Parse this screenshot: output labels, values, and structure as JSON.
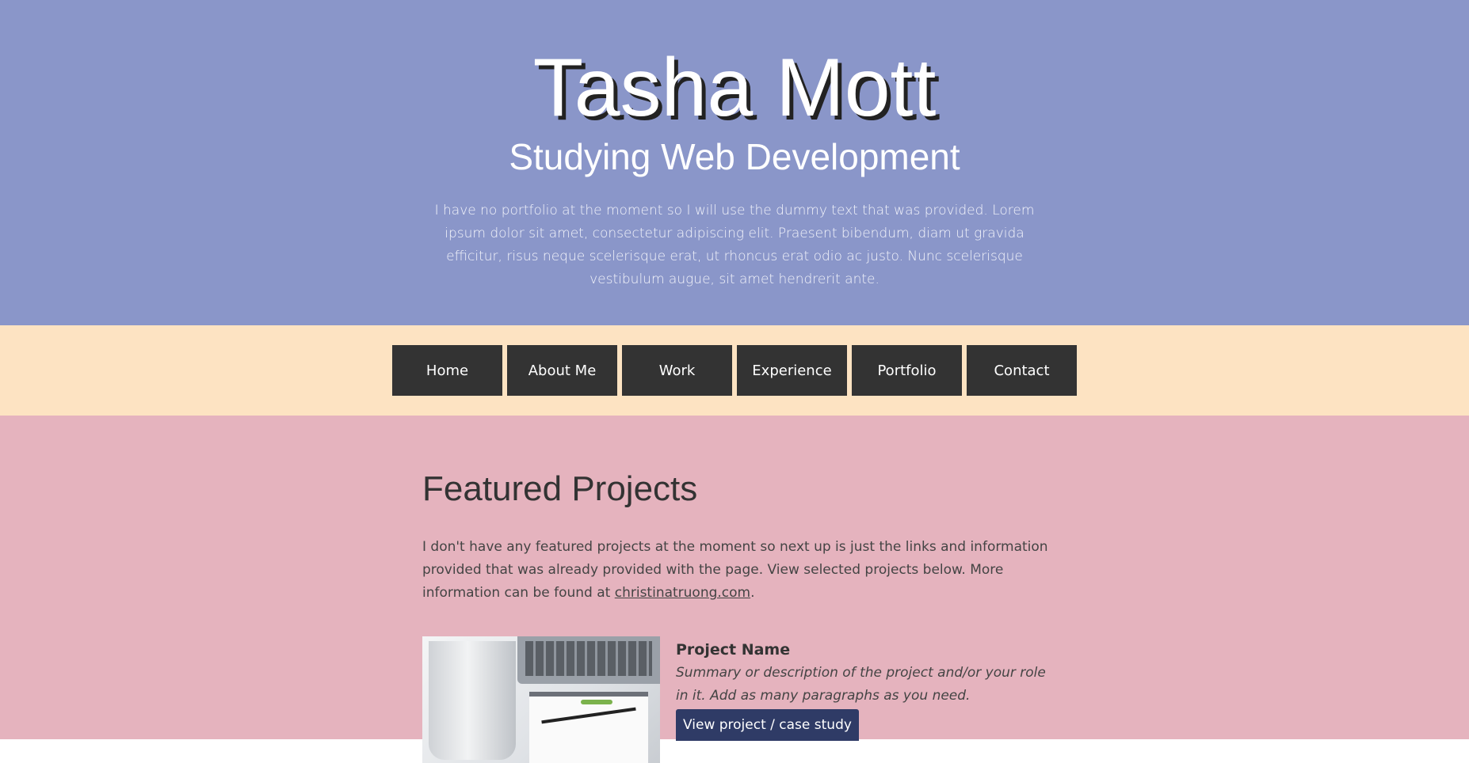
{
  "hero": {
    "name": "Tasha Mott",
    "subtitle": "Studying Web Development",
    "intro": "I have no portfolio at the moment so I will use the dummy text that was provided. Lorem ipsum dolor sit amet, consectetur adipiscing elit. Praesent bibendum, diam ut gravida efficitur, risus neque scelerisque erat, ut rhoncus erat odio ac justo. Nunc scelerisque vestibulum augue, sit amet hendrerit ante."
  },
  "nav": {
    "items": [
      {
        "label": "Home"
      },
      {
        "label": "About Me"
      },
      {
        "label": "Work"
      },
      {
        "label": "Experience"
      },
      {
        "label": "Portfolio"
      },
      {
        "label": "Contact"
      }
    ]
  },
  "featured": {
    "title": "Featured Projects",
    "text": "I don't have any featured projects at the moment so next up is just the links and information provided that was already provided with the page. View selected projects below. More information can be found at",
    "link_text": "christinatruong.com",
    "link_suffix": ".",
    "project": {
      "name": "Project Name",
      "summary": "Summary or description of the project and/or your role in it. Add as many paragraphs as you need.",
      "button_label": "View project / case study"
    }
  },
  "colors": {
    "hero_bg": "#8a96c9",
    "nav_bg": "#fde3c2",
    "nav_item_bg": "#333333",
    "main_bg": "#e5b3be",
    "button_bg": "#2f3b66"
  }
}
